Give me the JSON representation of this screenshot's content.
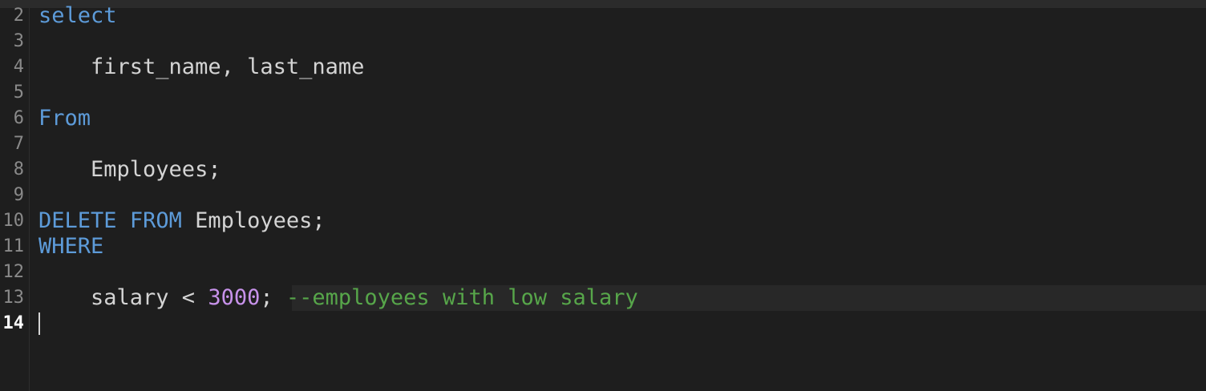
{
  "editor": {
    "language": "sql",
    "lines": [
      {
        "number": "2",
        "tokens": [
          {
            "type": "kw",
            "text": "select"
          }
        ]
      },
      {
        "number": "3",
        "tokens": []
      },
      {
        "number": "4",
        "tokens": [
          {
            "type": "id",
            "text": "    first_name, last_name"
          }
        ]
      },
      {
        "number": "5",
        "tokens": []
      },
      {
        "number": "6",
        "tokens": [
          {
            "type": "kw",
            "text": "From"
          }
        ]
      },
      {
        "number": "7",
        "tokens": []
      },
      {
        "number": "8",
        "tokens": [
          {
            "type": "id",
            "text": "    Employees;"
          }
        ]
      },
      {
        "number": "9",
        "tokens": []
      },
      {
        "number": "10",
        "tokens": [
          {
            "type": "kw",
            "text": "DELETE"
          },
          {
            "type": "id",
            "text": " "
          },
          {
            "type": "kw",
            "text": "FROM"
          },
          {
            "type": "id",
            "text": " Employees;"
          }
        ]
      },
      {
        "number": "11",
        "tokens": [
          {
            "type": "kw",
            "text": "WHERE"
          }
        ]
      },
      {
        "number": "12",
        "tokens": []
      },
      {
        "number": "13",
        "tokens": [
          {
            "type": "id",
            "text": "    salary < "
          },
          {
            "type": "num",
            "text": "3000"
          },
          {
            "type": "id",
            "text": "; "
          },
          {
            "type": "cmt",
            "text": "--employees with low salary"
          }
        ]
      },
      {
        "number": "14",
        "tokens": [],
        "current": true
      }
    ]
  },
  "colors": {
    "background": "#1e1e1e",
    "keyword": "#5d9bd9",
    "identifier": "#d4d4d4",
    "number": "#c792ea",
    "comment": "#57a64a",
    "line_number": "#8a8a8a"
  }
}
